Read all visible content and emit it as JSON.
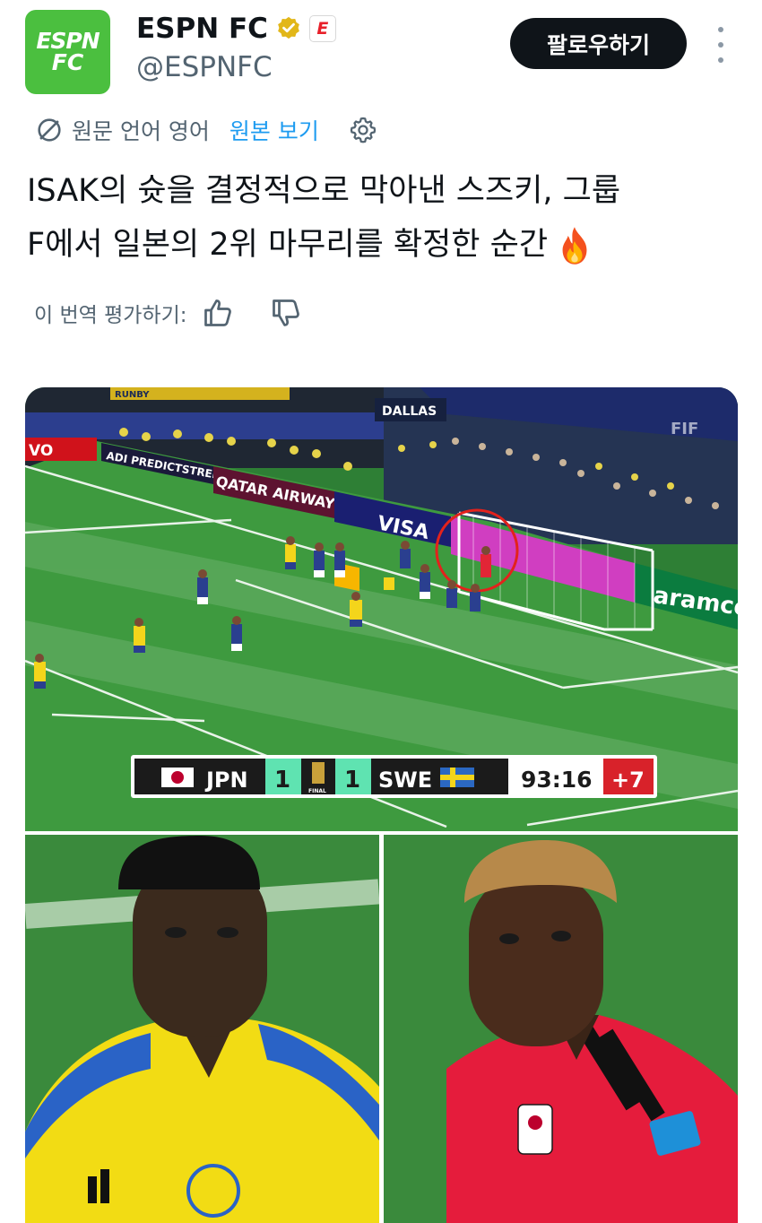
{
  "account": {
    "logo_line1": "ESPN",
    "logo_line2": "FC",
    "display_name": "ESPN FC",
    "affiliate_badge": "E",
    "handle": "@ESPNFC",
    "verified_icon": "verified-gold-badge-icon"
  },
  "header": {
    "follow_label": "팔로우하기",
    "more_icon": "more-options-icon"
  },
  "translation": {
    "language_note": "원문 언어 영어",
    "view_original": "원본 보기",
    "settings_icon": "gear-icon"
  },
  "tweet": {
    "line1": "ISAK의 슛을 결정적으로 막아낸 스즈키, 그룹",
    "line2": "F에서 일본의 2위 마무리를 확정한 순간",
    "emoji": "fire-emoji"
  },
  "rating": {
    "label": "이 번역 평가하기:",
    "like_icon": "thumbs-up-icon",
    "dislike_icon": "thumbs-down-icon"
  },
  "media": {
    "scoreboard": {
      "home_team": "JPN",
      "home_score": "1",
      "away_team": "SWE",
      "away_score": "1",
      "clock": "93:16",
      "added_time": "+7",
      "trophy_label": "FINAL"
    },
    "ad_boards": {
      "board1": "ADI PREDICTSTREET",
      "board2": "QATAR AIRWAYS",
      "board3": "VISA",
      "board4": "aramco",
      "board5": "VO",
      "banner_top": "DALLAS",
      "banner_left": "RUNBY",
      "banner_fifa": "FIF",
      "banner_fi": "FI"
    }
  },
  "colors": {
    "follow_bg": "#0f1419",
    "link_blue": "#1d9bf0",
    "muted": "#536471",
    "logo_green": "#4bbf3f",
    "pitch_green": "#3e9a3f"
  }
}
